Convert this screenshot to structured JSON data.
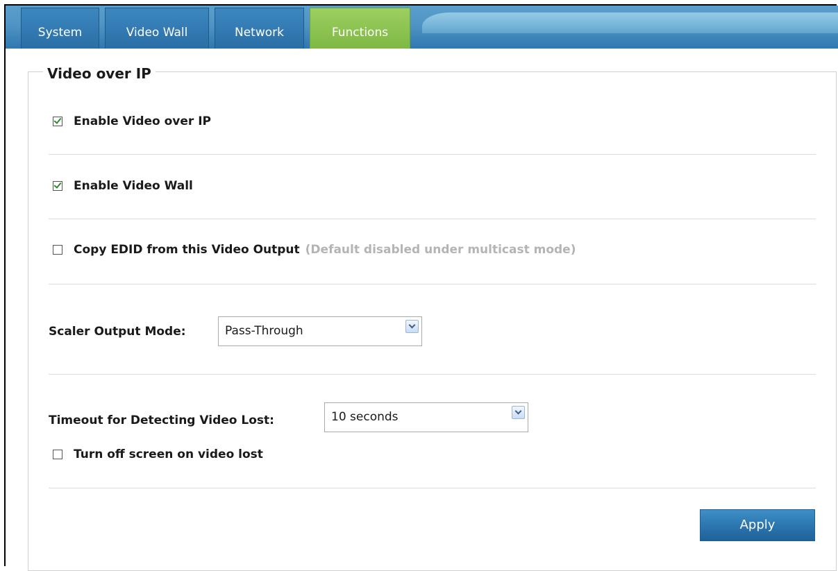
{
  "tabs": [
    {
      "label": "System",
      "active": false
    },
    {
      "label": "Video Wall",
      "active": false
    },
    {
      "label": "Network",
      "active": false
    },
    {
      "label": "Functions",
      "active": true
    }
  ],
  "section": {
    "title": "Video over IP"
  },
  "options": {
    "enable_video_over_ip": {
      "label": "Enable Video over IP",
      "checked": true
    },
    "enable_video_wall": {
      "label": "Enable Video Wall",
      "checked": true
    },
    "copy_edid": {
      "label": "Copy EDID from this Video Output",
      "hint": "(Default disabled under multicast mode)",
      "checked": false
    },
    "turn_off_screen": {
      "label": "Turn off screen on video lost",
      "checked": false
    }
  },
  "scaler": {
    "label": "Scaler Output Mode:",
    "value": "Pass-Through"
  },
  "timeout": {
    "label": "Timeout for Detecting Video Lost:",
    "value": "10 seconds"
  },
  "actions": {
    "apply_label": "Apply"
  },
  "colors": {
    "tab_blue": "#2a6fa6",
    "tab_active_green": "#7fb844",
    "hint_gray": "#b4b4b4",
    "checkmark_green": "#2b8a2b"
  }
}
